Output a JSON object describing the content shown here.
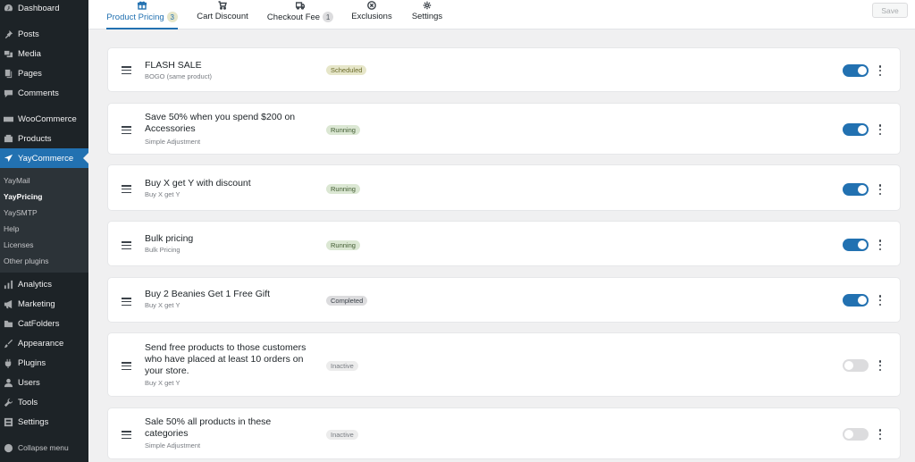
{
  "sidebar": {
    "items": [
      {
        "label": "Dashboard",
        "icon": "dashboard-icon"
      },
      {
        "label": "Posts",
        "icon": "pin-icon"
      },
      {
        "label": "Media",
        "icon": "media-icon"
      },
      {
        "label": "Pages",
        "icon": "pages-icon"
      },
      {
        "label": "Comments",
        "icon": "comment-icon"
      },
      {
        "label": "WooCommerce",
        "icon": "woo-icon"
      },
      {
        "label": "Products",
        "icon": "products-icon"
      },
      {
        "label": "YayCommerce",
        "icon": "plane-icon"
      },
      {
        "label": "Analytics",
        "icon": "bar-chart-icon"
      },
      {
        "label": "Marketing",
        "icon": "megaphone-icon"
      },
      {
        "label": "CatFolders",
        "icon": "folder-icon"
      },
      {
        "label": "Appearance",
        "icon": "brush-icon"
      },
      {
        "label": "Plugins",
        "icon": "plug-icon"
      },
      {
        "label": "Users",
        "icon": "user-icon"
      },
      {
        "label": "Tools",
        "icon": "wrench-icon"
      },
      {
        "label": "Settings",
        "icon": "settings-icon"
      },
      {
        "label": "Collapse menu",
        "icon": "collapse-icon"
      }
    ],
    "submenu": [
      "YayMail",
      "YayPricing",
      "YaySMTP",
      "Help",
      "Licenses",
      "Other plugins"
    ]
  },
  "tabs": [
    {
      "label": "Product Pricing",
      "count": "3",
      "icon": "gift-icon"
    },
    {
      "label": "Cart Discount",
      "count": "",
      "icon": "cart-icon"
    },
    {
      "label": "Checkout Fee",
      "count": "1",
      "icon": "truck-icon"
    },
    {
      "label": "Exclusions",
      "count": "",
      "icon": "x-circle-icon"
    },
    {
      "label": "Settings",
      "count": "",
      "icon": "gear-icon"
    }
  ],
  "save_label": "Save",
  "rules": [
    {
      "title": "FLASH SALE",
      "type": "BOGO (same product)",
      "status": "Scheduled",
      "enabled": true
    },
    {
      "title": "Save 50% when you spend $200 on Accessories",
      "type": "Simple Adjustment",
      "status": "Running",
      "enabled": true
    },
    {
      "title": "Buy X get Y with discount",
      "type": "Buy X get Y",
      "status": "Running",
      "enabled": true
    },
    {
      "title": "Bulk pricing",
      "type": "Bulk Pricing",
      "status": "Running",
      "enabled": true
    },
    {
      "title": "Buy 2 Beanies Get 1 Free Gift",
      "type": "Buy X get Y",
      "status": "Completed",
      "enabled": true
    },
    {
      "title": "Send free products to those customers who have placed at least 10 orders on your store.",
      "type": "Buy X get Y",
      "status": "Inactive",
      "enabled": false
    },
    {
      "title": "Sale 50% all products in these categories",
      "type": "Simple Adjustment",
      "status": "Inactive",
      "enabled": false
    }
  ],
  "colors": {
    "accent": "#2271b1",
    "scheduled": "#e6e6c9",
    "running": "#dbe7d3",
    "completed": "#dcdcde",
    "inactive": "#ececec"
  }
}
